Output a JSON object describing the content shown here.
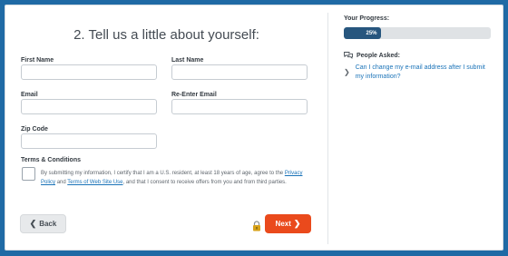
{
  "form": {
    "title": "2. Tell us a little about yourself:",
    "first_name_label": "First Name",
    "first_name_value": "",
    "last_name_label": "Last Name",
    "last_name_value": "",
    "email_label": "Email",
    "email_value": "",
    "reenter_email_label": "Re-Enter Email",
    "reenter_email_value": "",
    "zip_label": "Zip Code",
    "zip_value": "",
    "terms_heading": "Terms & Conditions",
    "terms_checked": false,
    "terms_text_1": "By submitting my information, I certify that I am a U.S. resident, at least 18 years of age, agree to the",
    "privacy_link": "Privacy Policy",
    "terms_and": "and",
    "terms_link": "Terms of Web Site Use",
    "terms_text_2": ", and that I consent to receive offers from you and from third parties.",
    "back_label": "Back",
    "next_label": "Next"
  },
  "sidebar": {
    "progress_label": "Your Progress:",
    "progress_value": 0.25,
    "progress_text": "25%",
    "people_asked_label": "People Asked:",
    "faq": [
      {
        "question": "Can I change my e-mail address after I submit my information?"
      }
    ]
  },
  "colors": {
    "background": "#1f6aa5",
    "accent_button": "#ea4a1c",
    "progress_fill": "#27567e",
    "link": "#1a73b8"
  },
  "icons": [
    "chevron-left-icon",
    "lock-icon",
    "chevron-right-icon",
    "chat-bubbles-icon",
    "chevron-right-icon"
  ]
}
